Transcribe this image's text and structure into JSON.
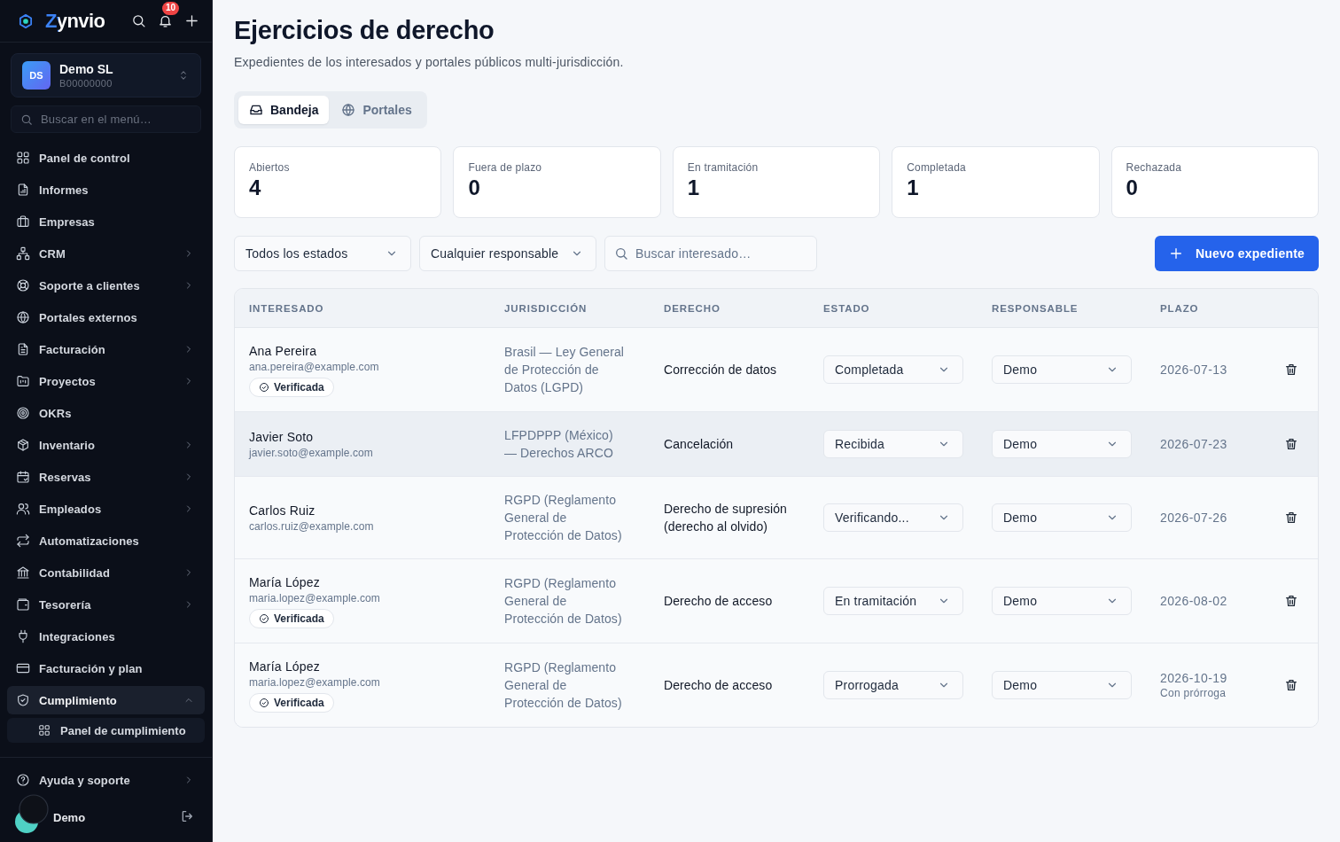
{
  "sidebar": {
    "brand": "Zynvio",
    "notification_count": "10",
    "workspace": {
      "initials": "DS",
      "name": "Demo SL",
      "tax_id": "B00000000"
    },
    "search": {
      "placeholder": "Buscar en el menú…"
    },
    "items": [
      {
        "label": "Panel de control",
        "expandable": false,
        "expanded": false,
        "selected": false
      },
      {
        "label": "Informes",
        "expandable": false,
        "expanded": false,
        "selected": false
      },
      {
        "label": "Empresas",
        "expandable": false,
        "expanded": false,
        "selected": false
      },
      {
        "label": "CRM",
        "expandable": true,
        "expanded": false,
        "selected": false
      },
      {
        "label": "Soporte a clientes",
        "expandable": true,
        "expanded": false,
        "selected": false
      },
      {
        "label": "Portales externos",
        "expandable": false,
        "expanded": false,
        "selected": false
      },
      {
        "label": "Facturación",
        "expandable": true,
        "expanded": false,
        "selected": false
      },
      {
        "label": "Proyectos",
        "expandable": true,
        "expanded": false,
        "selected": false
      },
      {
        "label": "OKRs",
        "expandable": false,
        "expanded": false,
        "selected": false
      },
      {
        "label": "Inventario",
        "expandable": true,
        "expanded": false,
        "selected": false
      },
      {
        "label": "Reservas",
        "expandable": true,
        "expanded": false,
        "selected": false
      },
      {
        "label": "Empleados",
        "expandable": true,
        "expanded": false,
        "selected": false
      },
      {
        "label": "Automatizaciones",
        "expandable": false,
        "expanded": false,
        "selected": false
      },
      {
        "label": "Contabilidad",
        "expandable": true,
        "expanded": false,
        "selected": false
      },
      {
        "label": "Tesorería",
        "expandable": true,
        "expanded": false,
        "selected": false
      },
      {
        "label": "Integraciones",
        "expandable": false,
        "expanded": false,
        "selected": false
      },
      {
        "label": "Facturación y plan",
        "expandable": false,
        "expanded": false,
        "selected": false
      },
      {
        "label": "Cumplimiento",
        "expandable": true,
        "expanded": true,
        "selected": true,
        "children": [
          {
            "label": "Panel de cumplimiento"
          }
        ]
      }
    ],
    "footer": {
      "help": "Ayuda y soporte",
      "user": "Demo"
    }
  },
  "page": {
    "title": "Ejercicios de derecho",
    "subtitle": "Expedientes de los interesados y portales públicos multi-jurisdicción."
  },
  "tabs": [
    {
      "label": "Bandeja",
      "selected": true
    },
    {
      "label": "Portales",
      "selected": false
    }
  ],
  "stats": [
    {
      "label": "Abiertos",
      "value": "4"
    },
    {
      "label": "Fuera de plazo",
      "value": "0"
    },
    {
      "label": "En tramitación",
      "value": "1"
    },
    {
      "label": "Completada",
      "value": "1"
    },
    {
      "label": "Rechazada",
      "value": "0"
    }
  ],
  "filters": {
    "status": "Todos los estados",
    "owner": "Cualquier responsable",
    "search_placeholder": "Buscar interesado…"
  },
  "new_button": "Nuevo expediente",
  "table": {
    "columns": [
      "INTERESADO",
      "JURISDICCIÓN",
      "DERECHO",
      "ESTADO",
      "RESPONSABLE",
      "PLAZO"
    ],
    "rows": [
      {
        "name": "Ana Pereira",
        "email": "ana.pereira@example.com",
        "badge": "Verificada",
        "jurisdiction": "Brasil — Ley General de Protección de Datos (LGPD)",
        "right": "Corrección de datos",
        "status": "Completada",
        "owner": "Demo",
        "deadline": "2026-07-13",
        "highlighted": false
      },
      {
        "name": "Javier Soto",
        "email": "javier.soto@example.com",
        "jurisdiction": "LFPDPPP (México) — Derechos ARCO",
        "right": "Cancelación",
        "status": "Recibida",
        "owner": "Demo",
        "deadline": "2026-07-23",
        "highlighted": true
      },
      {
        "name": "Carlos Ruiz",
        "email": "carlos.ruiz@example.com",
        "jurisdiction": "RGPD (Reglamento General de Protección de Datos)",
        "right": "Derecho de supresión (derecho al olvido)",
        "status": "Verificando...",
        "owner": "Demo",
        "deadline": "2026-07-26",
        "highlighted": false
      },
      {
        "name": "María López",
        "email": "maria.lopez@example.com",
        "badge": "Verificada",
        "jurisdiction": "RGPD (Reglamento General de Protección de Datos)",
        "right": "Derecho de acceso",
        "status": "En tramitación",
        "owner": "Demo",
        "deadline": "2026-08-02",
        "highlighted": false
      },
      {
        "name": "María López",
        "email": "maria.lopez@example.com",
        "badge": "Verificada",
        "jurisdiction": "RGPD (Reglamento General de Protección de Datos)",
        "right": "Derecho de acceso",
        "status": "Prorrogada",
        "owner": "Demo",
        "deadline": "2026-10-19",
        "deadline_note": "Con prórroga",
        "highlighted": false
      }
    ]
  }
}
